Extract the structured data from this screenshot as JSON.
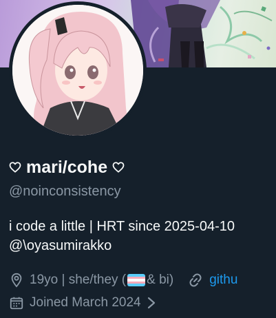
{
  "profile": {
    "display_name": "mari/cohe",
    "handle": "@noinconsistency",
    "bio_line1": "i code a little | HRT since 2025-04-10",
    "bio_line2": "@\\oyasumirakko",
    "location_before": "19yo | she/they (",
    "location_after": " & bi)",
    "website": "githu",
    "joined": "Joined March 2024"
  },
  "icons": {
    "heart_left": "heart-outline-icon",
    "heart_right": "heart-outline-icon",
    "location": "location-pin-icon",
    "link": "link-icon",
    "calendar": "calendar-icon",
    "chevron": "chevron-right-icon"
  },
  "colors": {
    "background": "#15202b",
    "text_primary": "#f7f9f9",
    "text_secondary": "#8b98a5",
    "link": "#1d9bf0"
  }
}
